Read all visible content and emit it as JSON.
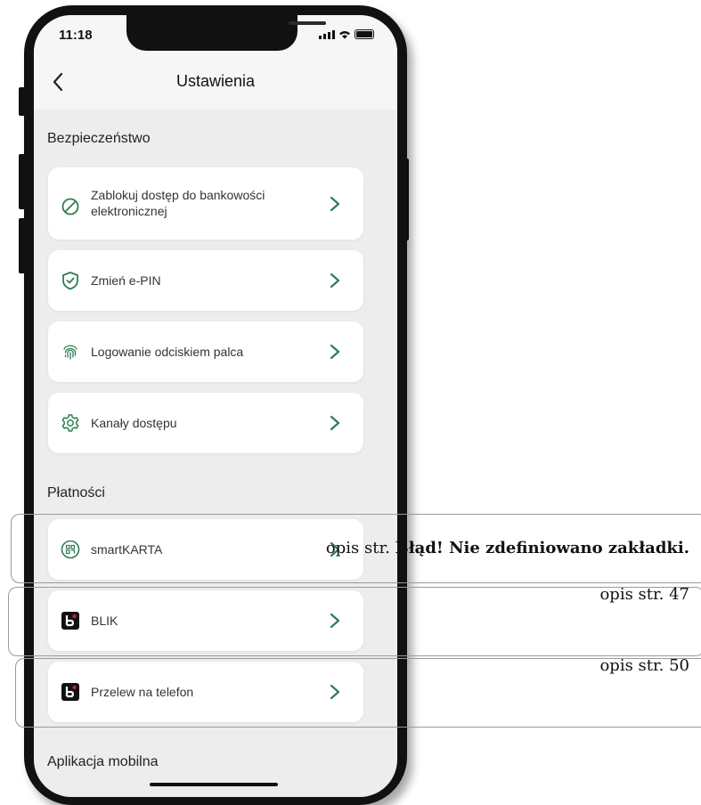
{
  "status_bar": {
    "time": "11:18"
  },
  "navbar": {
    "title": "Ustawienia",
    "back_icon": "chevron-left-icon"
  },
  "sections": {
    "security": {
      "title": "Bezpieczeństwo",
      "items": [
        {
          "label_line1": "Zablokuj dostęp do bankowości",
          "label_line2": "elektronicznej",
          "icon": "block-icon"
        },
        {
          "label": "Zmień e-PIN",
          "icon": "shield-check-icon"
        },
        {
          "label": "Logowanie odciskiem palca",
          "icon": "fingerprint-icon"
        },
        {
          "label": "Kanały dostępu",
          "icon": "gear-icon"
        }
      ]
    },
    "payments": {
      "title": "Płatności",
      "items": [
        {
          "label": "smartKARTA",
          "icon": "qr-card-icon"
        },
        {
          "label": "BLIK",
          "icon": "blik-icon"
        },
        {
          "label": "Przelew na telefon",
          "icon": "blik-icon"
        }
      ]
    },
    "mobile_app": {
      "title": "Aplikacja mobilna"
    }
  },
  "annotations": [
    {
      "prefix": "opis str. ",
      "bold": "Błąd! Nie zdefiniowano zakładki."
    },
    {
      "text": "opis str. 47"
    },
    {
      "text": "opis str. 50"
    }
  ],
  "colors": {
    "accent": "#2e7d52",
    "card": "#ffffff",
    "background": "#ededed"
  }
}
